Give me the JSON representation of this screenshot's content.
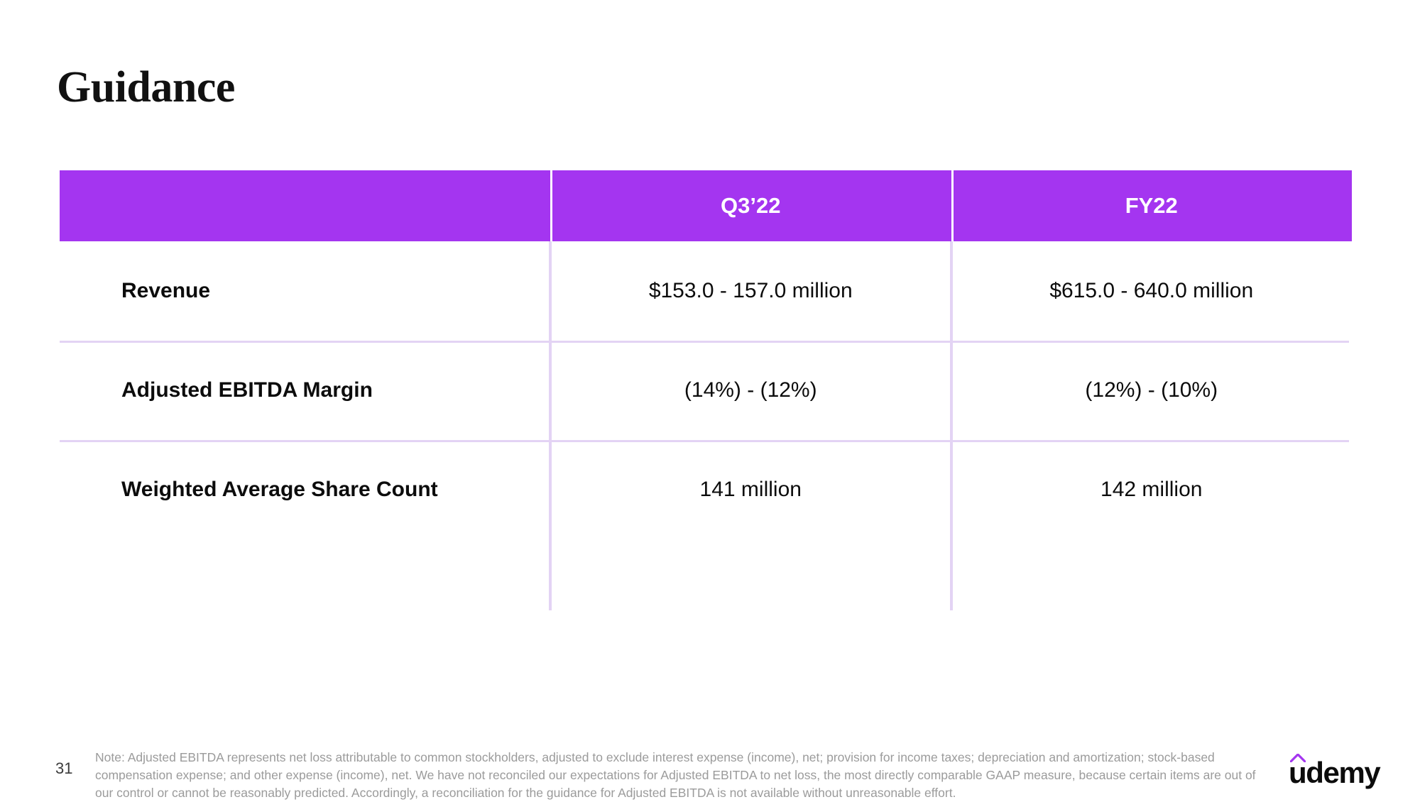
{
  "slide": {
    "title": "Guidance",
    "page_number": "31",
    "header_color": "#A435F0",
    "rule_color": "#E3D3F4"
  },
  "table": {
    "columns": [
      {
        "label": ""
      },
      {
        "label": "Q3’22"
      },
      {
        "label": "FY22"
      }
    ],
    "rows": [
      {
        "label": "Revenue",
        "q3_22": "$153.0 - 157.0 million",
        "fy22": "$615.0 - 640.0 million"
      },
      {
        "label": "Adjusted EBITDA Margin",
        "q3_22": "(14%) - (12%)",
        "fy22": "(12%) - (10%)"
      },
      {
        "label": "Weighted Average Share Count",
        "q3_22": "141 million",
        "fy22": "142 million"
      }
    ]
  },
  "footnote": {
    "line1": "Note: Adjusted EBITDA represents net loss attributable to common stockholders, adjusted to exclude interest expense (income), net; provision for income taxes; depreciation and amortization; stock-based",
    "line2": "compensation expense; and other expense (income), net. We have not reconciled our expectations for Adjusted EBITDA to net loss, the most directly comparable GAAP measure, because certain items are out of",
    "line3": "our control or cannot be reasonably predicted. Accordingly, a reconciliation for the guidance for Adjusted EBITDA is not available without unreasonable effort."
  },
  "logo": {
    "wordmark": "udemy",
    "caret_color": "#A435F0",
    "text_color": "#0C0C0C"
  }
}
